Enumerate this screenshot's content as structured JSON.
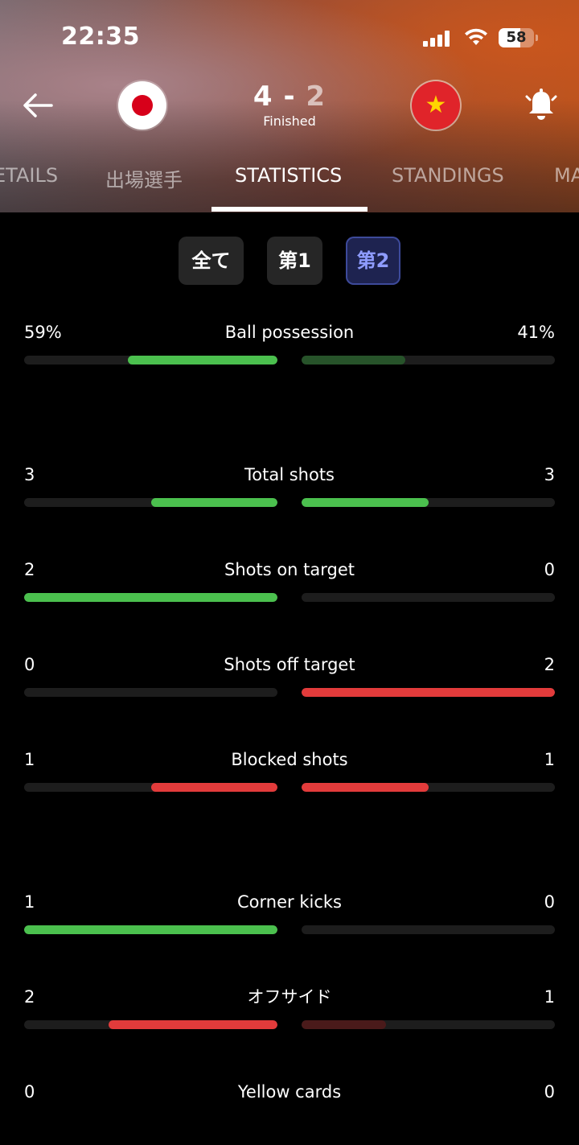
{
  "status_bar": {
    "time": "22:35",
    "battery": "58"
  },
  "match": {
    "home_score": "4",
    "separator": "-",
    "away_score": "2",
    "status": "Finished",
    "home_icon": "japan-flag-icon",
    "away_icon": "vietnam-flag-icon"
  },
  "tabs": [
    {
      "label": "ETAILS"
    },
    {
      "label": "出場選手"
    },
    {
      "label": "STATISTICS"
    },
    {
      "label": "STANDINGS"
    },
    {
      "label": "MA"
    }
  ],
  "periods": [
    {
      "label": "全て"
    },
    {
      "label": "第1"
    },
    {
      "label": "第2"
    }
  ],
  "colors": {
    "green": "#4bc04e",
    "dark_green": "#27532a",
    "red": "#e23b3b",
    "dark_red": "#4a1a1a",
    "track": "#1d1d1d",
    "active_period": "#8f9cff"
  },
  "stats": [
    {
      "label": "Ball possession",
      "home": "59%",
      "away": "41%",
      "home_level": 0.59,
      "away_level": 0.41,
      "home_color": "green",
      "away_color": "dark_green"
    },
    {
      "label": "Total shots",
      "home": "3",
      "away": "3",
      "home_level": 0.5,
      "away_level": 0.5,
      "home_color": "green",
      "away_color": "green"
    },
    {
      "label": "Shots on target",
      "home": "2",
      "away": "0",
      "home_level": 1.0,
      "away_level": 0,
      "home_color": "green",
      "away_color": "green"
    },
    {
      "label": "Shots off target",
      "home": "0",
      "away": "2",
      "home_level": 0,
      "away_level": 1.0,
      "home_color": "red",
      "away_color": "red"
    },
    {
      "label": "Blocked shots",
      "home": "1",
      "away": "1",
      "home_level": 0.5,
      "away_level": 0.5,
      "home_color": "red",
      "away_color": "red"
    },
    {
      "label": "Corner kicks",
      "home": "1",
      "away": "0",
      "home_level": 1.0,
      "away_level": 0,
      "home_color": "green",
      "away_color": "green"
    },
    {
      "label": "オフサイド",
      "home": "2",
      "away": "1",
      "home_level": 0.667,
      "away_level": 0.333,
      "home_color": "red",
      "away_color": "dark_red"
    },
    {
      "label": "Yellow cards",
      "home": "0",
      "away": "0",
      "home_level": 0,
      "away_level": 0,
      "home_color": "red",
      "away_color": "red"
    }
  ]
}
